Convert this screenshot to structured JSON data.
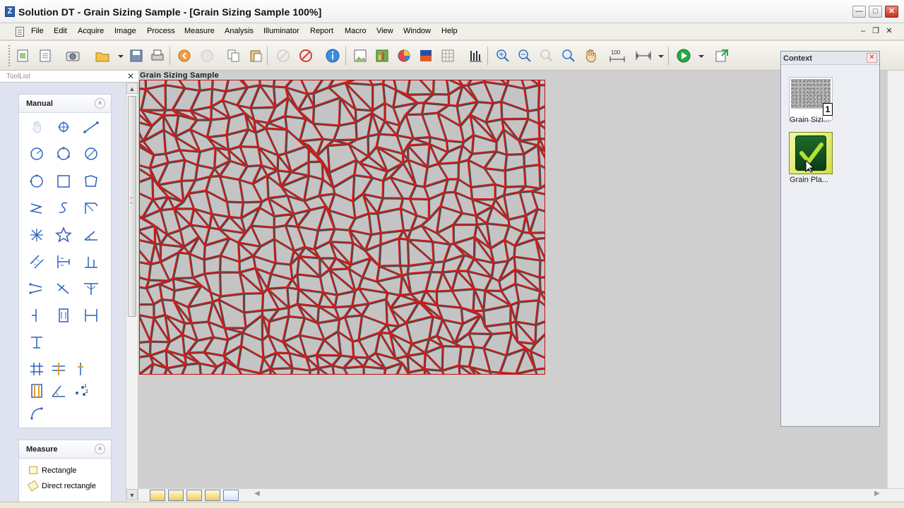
{
  "window": {
    "title": "Solution DT - Grain Sizing Sample - [Grain Sizing Sample 100%]",
    "app_icon_glyph": "Z",
    "minimize_glyph": "—",
    "maximize_glyph": "□",
    "close_glyph": "✕"
  },
  "menu": {
    "items": [
      "File",
      "Edit",
      "Acquire",
      "Image",
      "Process",
      "Measure",
      "Analysis",
      "Illuminator",
      "Report",
      "Macro",
      "View",
      "Window",
      "Help"
    ],
    "mdi_minimize_glyph": "–",
    "mdi_restore_glyph": "❐",
    "mdi_close_glyph": "✕"
  },
  "toolbar": {
    "zoom_level_label": "100",
    "icons": [
      "new-image-icon",
      "new-document-icon",
      "camera-icon",
      "open-folder-icon",
      "save-icon",
      "print-icon",
      "back-icon",
      "forward-icon",
      "copy-icon",
      "paste-icon",
      "no-entry-disabled-icon",
      "no-entry-icon",
      "info-icon",
      "image-icon",
      "chart-icon",
      "pie-chart-icon",
      "histogram-icon",
      "grid-icon",
      "bars-icon",
      "zoom-in-icon",
      "zoom-out-icon",
      "zoom-fit-icon",
      "zoom-icon",
      "pan-hand-icon",
      "scale-icon",
      "measure-icon",
      "run-icon",
      "macro-icon"
    ]
  },
  "toollist": {
    "title": "ToolList",
    "close_glyph": "✕",
    "groups": [
      {
        "title": "Manual",
        "collapse_glyph": "˄"
      },
      {
        "title": "Measure",
        "collapse_glyph": "˄"
      }
    ],
    "measure_items": [
      "Rectangle",
      "Direct rectangle"
    ]
  },
  "document": {
    "title": "Grain Sizing Sample"
  },
  "context": {
    "title": "Context",
    "close_glyph": "✕",
    "items": [
      {
        "label": "Grain Sizi...",
        "badge": "1"
      },
      {
        "label": "Grain Pla..."
      }
    ]
  },
  "colors": {
    "accent_red": "#e01616",
    "panel_blue": "#dee3ef",
    "doc_bg": "#cfcfcf"
  }
}
